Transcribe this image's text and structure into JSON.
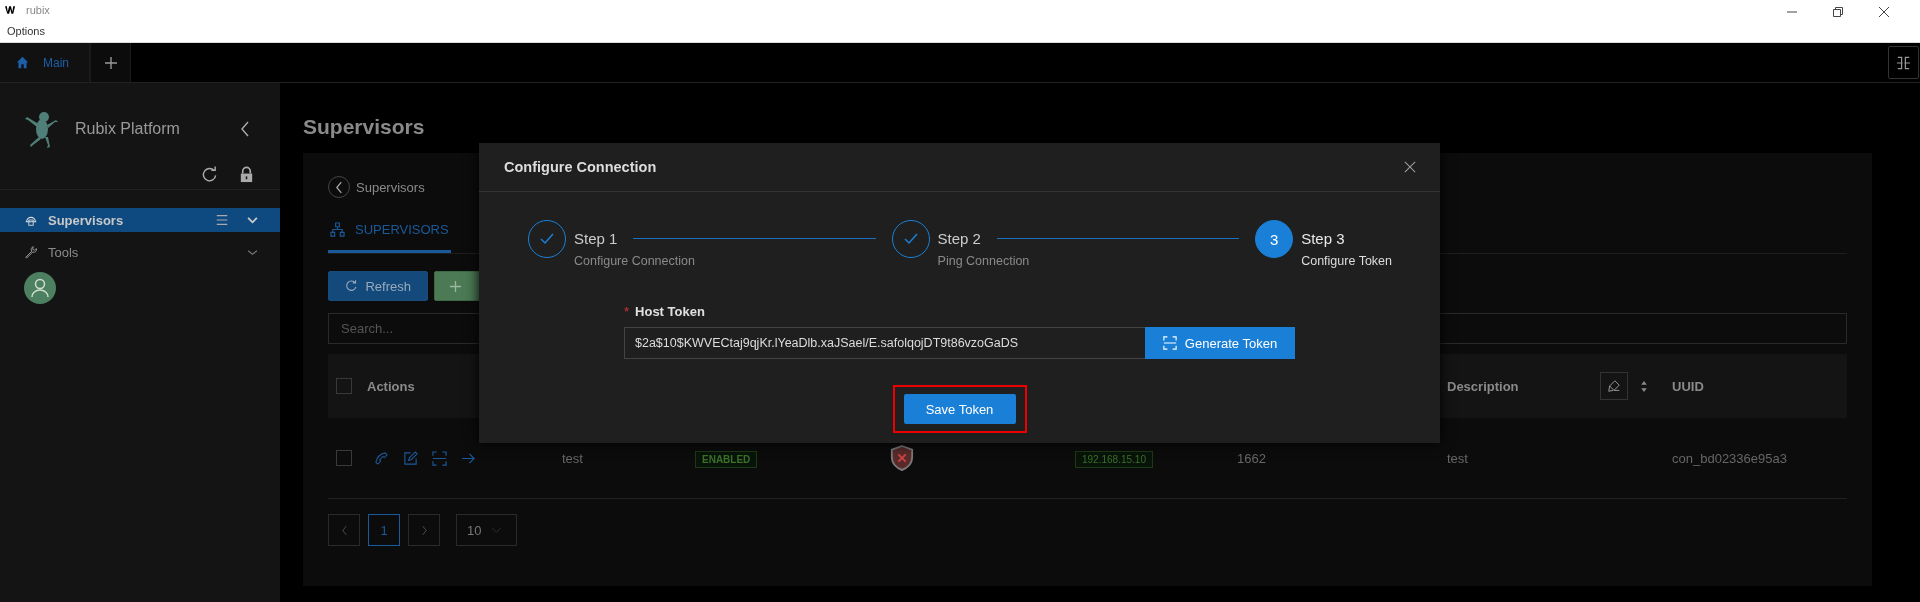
{
  "window": {
    "title": "rubix",
    "menu": [
      "Options"
    ]
  },
  "app_tabs": [
    {
      "label": "Main",
      "selected": true
    }
  ],
  "sidebar": {
    "brand": "Rubix Platform",
    "items": [
      {
        "label": "Supervisors",
        "selected": true,
        "expanded": true
      },
      {
        "label": "Tools",
        "selected": false,
        "expanded": false
      }
    ]
  },
  "page": {
    "title": "Supervisors",
    "breadcrumb": "Supervisors",
    "tabs": [
      {
        "label": "SUPERVISORS",
        "selected": true
      }
    ],
    "buttons": [
      {
        "label": "Refresh",
        "kind": "refresh"
      }
    ],
    "search": {
      "placeholder": "Search..."
    },
    "table": {
      "select_all": false,
      "columns": [
        "Actions",
        "Description",
        "UUID"
      ],
      "rows": [
        {
          "selected": false,
          "name": "test",
          "status": "ENABLED",
          "address": "192.168.15.10",
          "port": "1662",
          "description": "test",
          "uuid": "con_bd02336e95a3"
        }
      ]
    },
    "pagination": {
      "pages": [
        {
          "label": "1",
          "selected": true
        }
      ],
      "page_size": "10"
    }
  },
  "dialog": {
    "title": "Configure Connection",
    "steps": [
      {
        "title": "Step 1",
        "subtitle": "Configure Connection",
        "completed": true,
        "active": false
      },
      {
        "title": "Step 2",
        "subtitle": "Ping Connection",
        "completed": true,
        "active": false
      },
      {
        "title": "Step 3",
        "subtitle": "Configure Token",
        "completed": false,
        "active": true,
        "number": "3"
      }
    ],
    "field": {
      "label": "Host Token",
      "required_mark": "*",
      "value": "$2a$10$KWVECtaj9qjKr.lYeaDlb.xaJSael/E.safolqojDT9t86vzoGaDS"
    },
    "generate_button": "Generate Token",
    "save_button": {
      "label": "Save Token",
      "highlighted": true
    }
  }
}
